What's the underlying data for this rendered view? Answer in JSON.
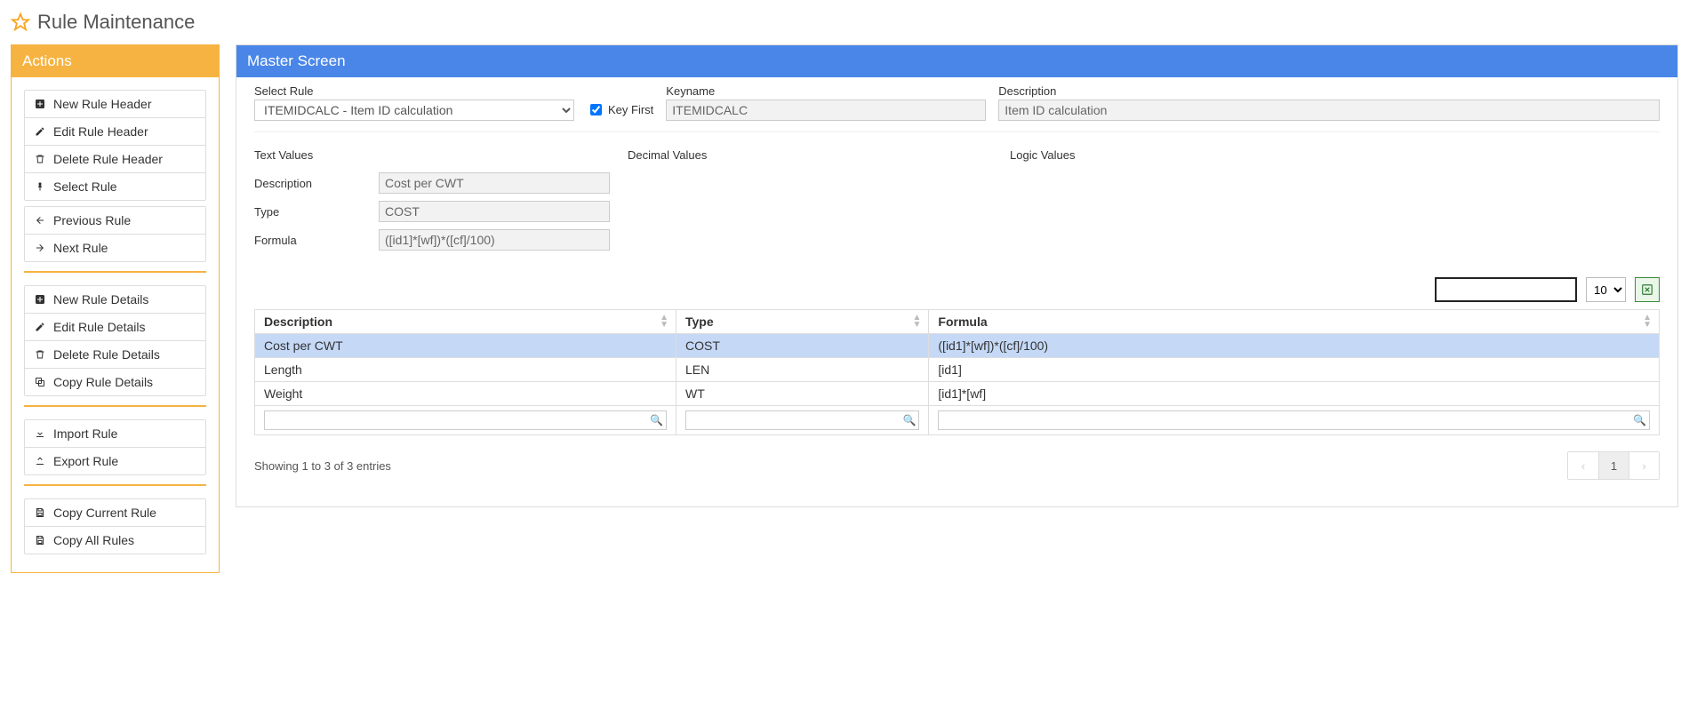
{
  "page": {
    "title": "Rule Maintenance"
  },
  "sidebar": {
    "title": "Actions",
    "groups": [
      [
        {
          "icon": "plus-square",
          "label": "New Rule Header"
        },
        {
          "icon": "pencil",
          "label": "Edit Rule Header"
        },
        {
          "icon": "trash",
          "label": "Delete Rule Header"
        },
        {
          "icon": "pin",
          "label": "Select Rule"
        }
      ],
      [
        {
          "icon": "arrow-left",
          "label": "Previous Rule"
        },
        {
          "icon": "arrow-right",
          "label": "Next Rule"
        }
      ],
      [
        {
          "icon": "plus-square",
          "label": "New Rule Details"
        },
        {
          "icon": "pencil",
          "label": "Edit Rule Details"
        },
        {
          "icon": "trash",
          "label": "Delete Rule Details"
        },
        {
          "icon": "copy",
          "label": "Copy Rule Details"
        }
      ],
      [
        {
          "icon": "download",
          "label": "Import Rule"
        },
        {
          "icon": "upload",
          "label": "Export Rule"
        }
      ],
      [
        {
          "icon": "save",
          "label": "Copy Current Rule"
        },
        {
          "icon": "save",
          "label": "Copy All Rules"
        }
      ]
    ]
  },
  "main": {
    "title": "Master Screen",
    "selectRule": {
      "label": "Select Rule",
      "value": "ITEMIDCALC - Item ID calculation"
    },
    "keyFirst": {
      "label": "Key First",
      "checked": true
    },
    "keyname": {
      "label": "Keyname",
      "value": "ITEMIDCALC"
    },
    "description": {
      "label": "Description",
      "value": "Item ID calculation"
    },
    "sections": {
      "text": "Text Values",
      "decimal": "Decimal Values",
      "logic": "Logic Values"
    },
    "textFields": {
      "description": {
        "label": "Description",
        "value": "Cost per CWT"
      },
      "type": {
        "label": "Type",
        "value": "COST"
      },
      "formula": {
        "label": "Formula",
        "value": "([id1]*[wf])*([cf]/100)"
      }
    },
    "table": {
      "searchValue": "",
      "pageSize": "10",
      "columns": [
        "Description",
        "Type",
        "Formula"
      ],
      "rows": [
        {
          "description": "Cost per CWT",
          "type": "COST",
          "formula": "([id1]*[wf])*([cf]/100)",
          "selected": true
        },
        {
          "description": "Length",
          "type": "LEN",
          "formula": "[id1]",
          "selected": false
        },
        {
          "description": "Weight",
          "type": "WT",
          "formula": "[id1]*[wf]",
          "selected": false
        }
      ],
      "info": "Showing 1 to 3 of 3 entries",
      "currentPage": "1"
    }
  }
}
